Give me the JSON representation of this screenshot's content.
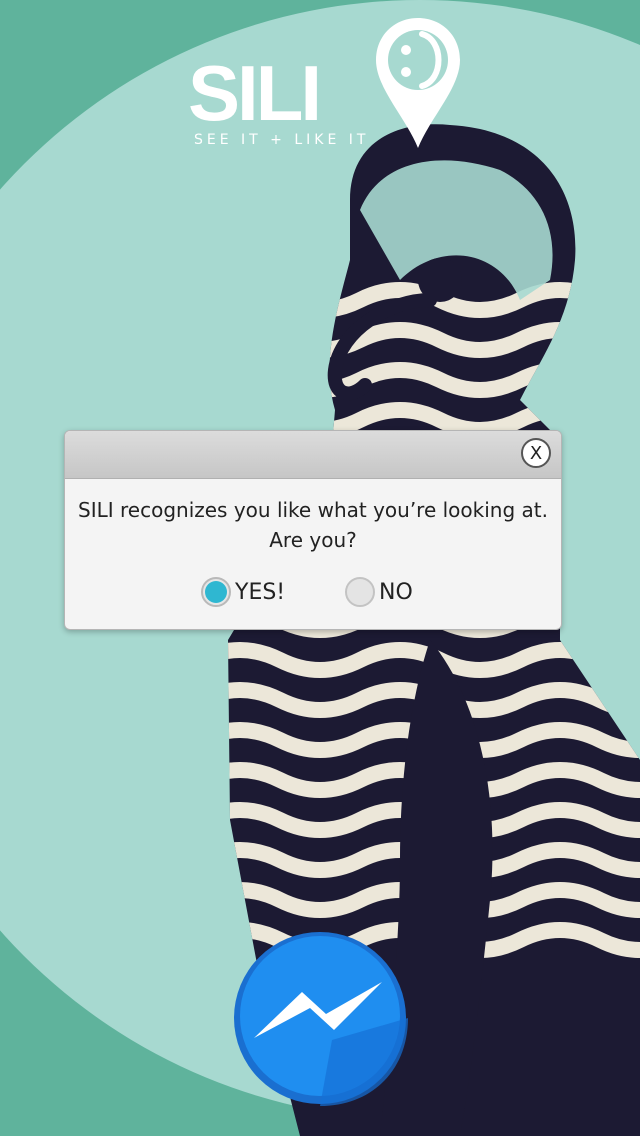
{
  "app": {
    "logo_text": "SILI",
    "tagline": "SEE IT + LIKE IT"
  },
  "dialog": {
    "message_line1": "SILI recognizes you like what you’re looking at.",
    "message_line2": "Are you?",
    "close_label": "X",
    "options": [
      {
        "label": "YES!",
        "selected": true
      },
      {
        "label": "NO",
        "selected": false
      }
    ]
  },
  "icons": {
    "logo_pin": "location-pin-smiley-icon",
    "messenger": "messenger-icon"
  },
  "colors": {
    "background_dark": "#5fb39c",
    "background_light": "#a7d9d0",
    "accent_radio": "#2fb7d1",
    "messenger_blue": "#1f8ef0",
    "figure_navy": "#1c1a33",
    "figure_cream": "#ece7d9"
  }
}
